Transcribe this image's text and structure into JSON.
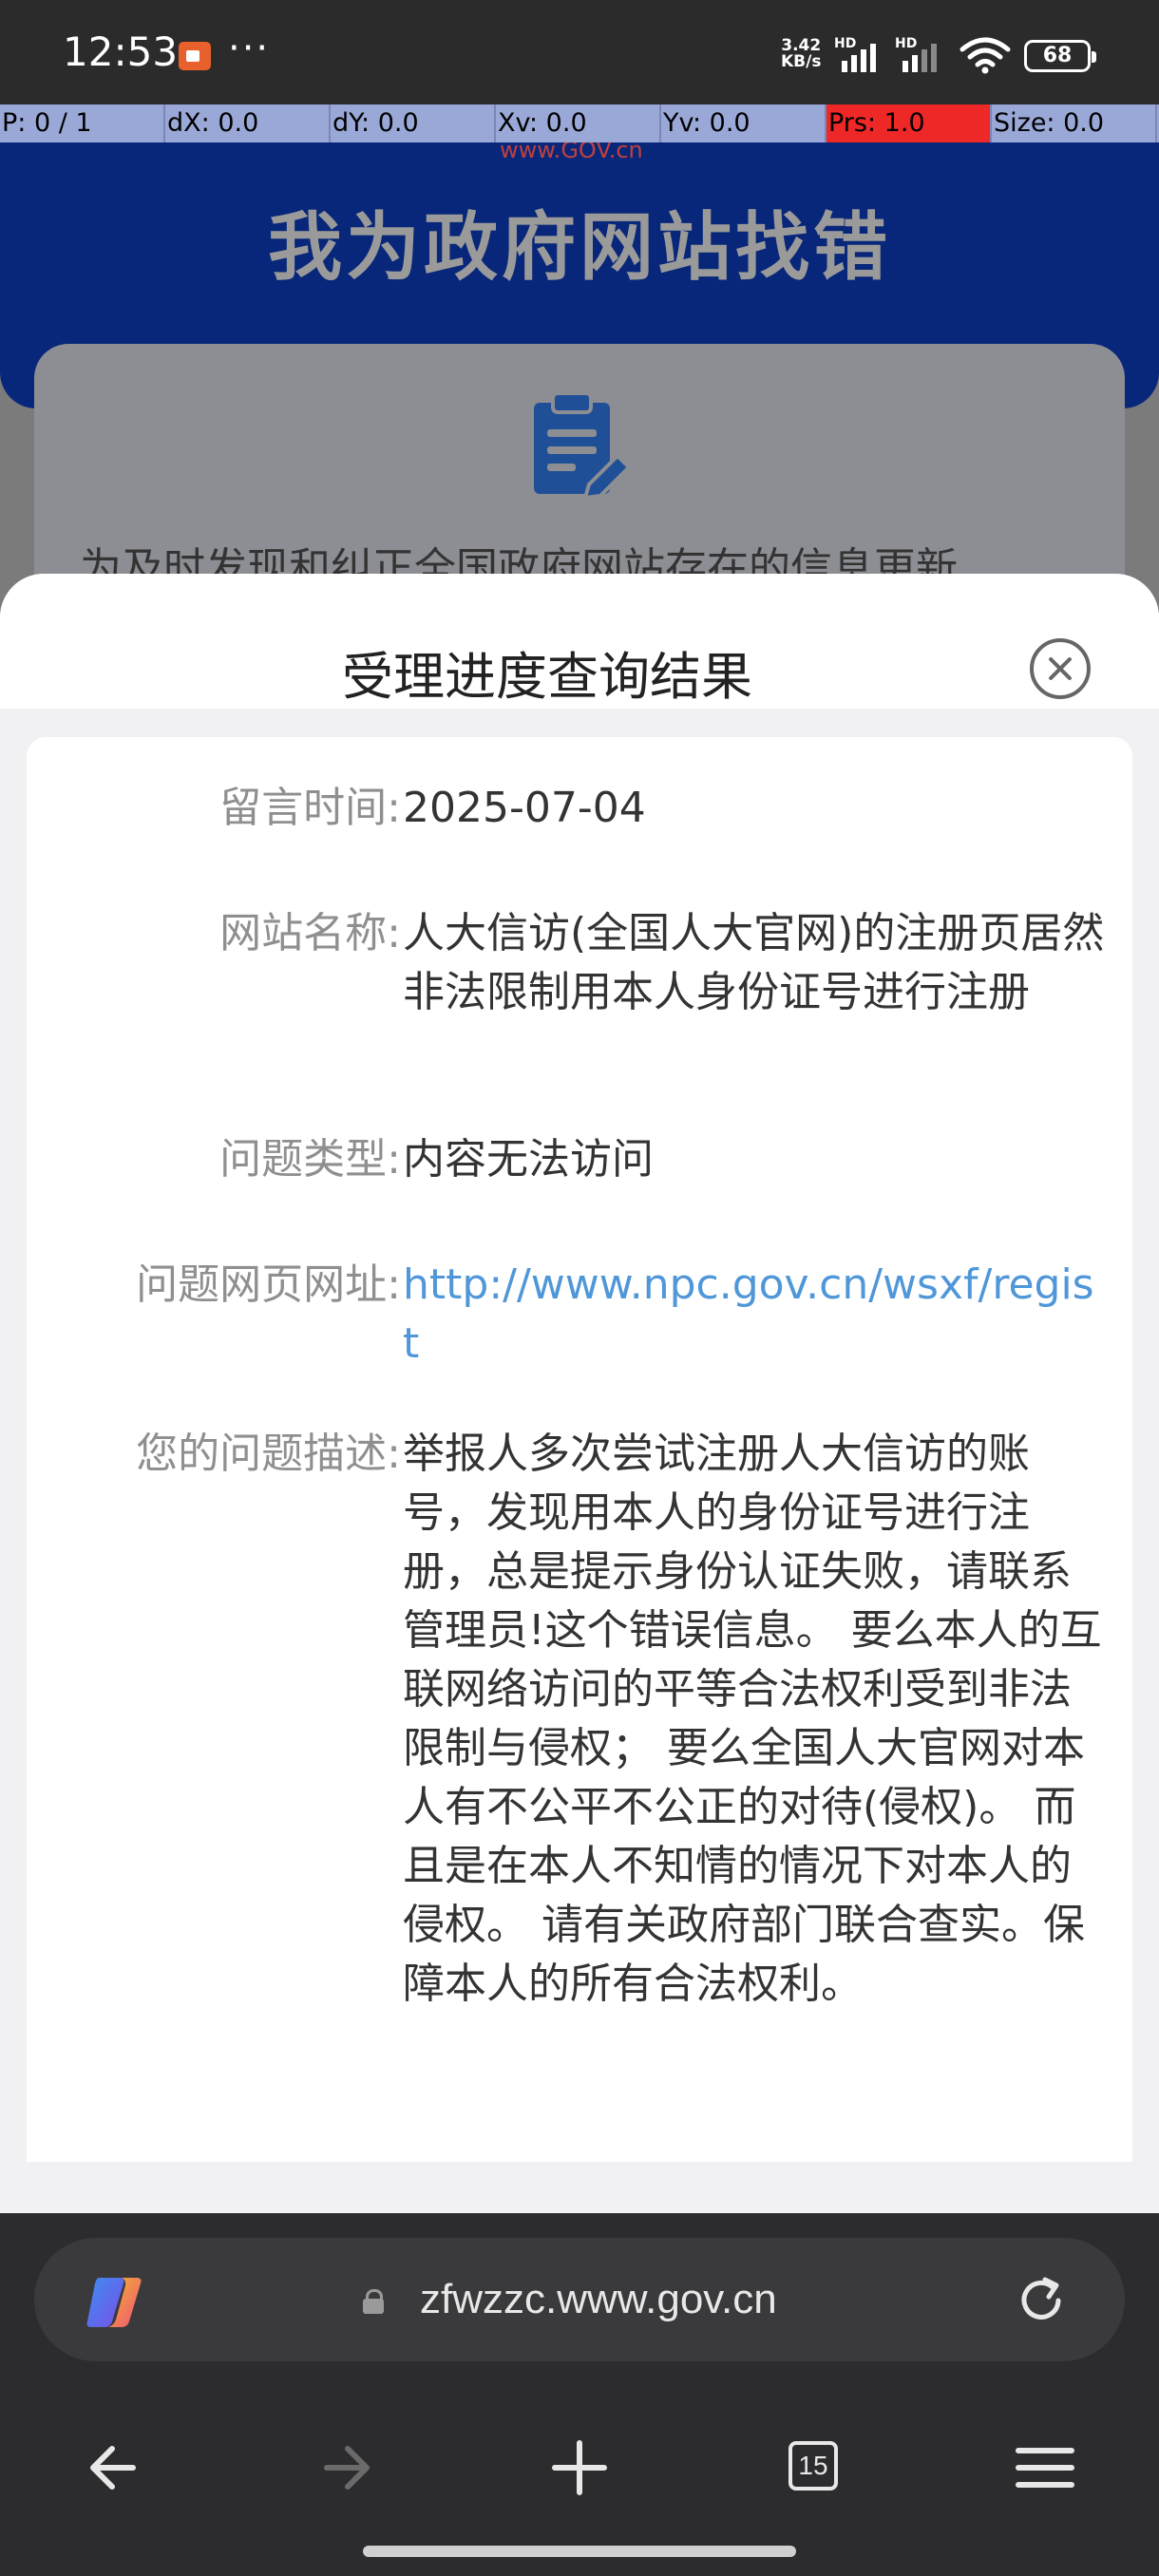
{
  "status_bar": {
    "time": "12:53",
    "more": "···",
    "net_speed_value": "3.42",
    "net_speed_unit": "KB/s",
    "signal_1_label": "HD",
    "signal_2_label": "HD",
    "battery": "68"
  },
  "debug_overlay": [
    "P: 0 / 1",
    "dX: 0.0",
    "dY: 0.0",
    "Xv: 0.0",
    "Yv: 0.0",
    "Prs: 1.0",
    "Size: 0.0"
  ],
  "webpage": {
    "logo_text": "www.GOV.cn",
    "hero_title": "我为政府网站找错",
    "intro_text": "为及时发现和纠正全国政府网站存在的信息更新"
  },
  "sheet": {
    "title": "受理进度查询结果",
    "rows": [
      {
        "label": "留言时间:",
        "value": "2025-07-04"
      },
      {
        "label": "网站名称:",
        "value": "人大信访(全国人大官网)的注册页居然非法限制用本人身份证号进行注册"
      },
      {
        "label": "问题类型:",
        "value": "内容无法访问"
      },
      {
        "label": "问题网页网址:",
        "value": "http://www.npc.gov.cn/wsxf/regist"
      },
      {
        "label": "您的问题描述:",
        "value": "举报人多次尝试注册人大信访的账号，发现用本人的身份证号进行注册，总是提示身份认证失败，请联系管理员!这个错误信息。 要么本人的互联网络访问的平等合法权利受到非法限制与侵权； 要么全国人大官网对本人有不公平不公正的对待(侵权)。 而且是在本人不知情的情况下对本人的侵权。 请有关政府部门联合查实。保障本人的所有合法权利。"
      }
    ]
  },
  "browser": {
    "url": "zfwzzc.www.gov.cn",
    "tab_count": "15"
  },
  "colors": {
    "hero_bg": "#08277a",
    "link": "#4f97d8",
    "debug_bar": "#9aa8d8",
    "debug_alert": "#ee2727"
  }
}
